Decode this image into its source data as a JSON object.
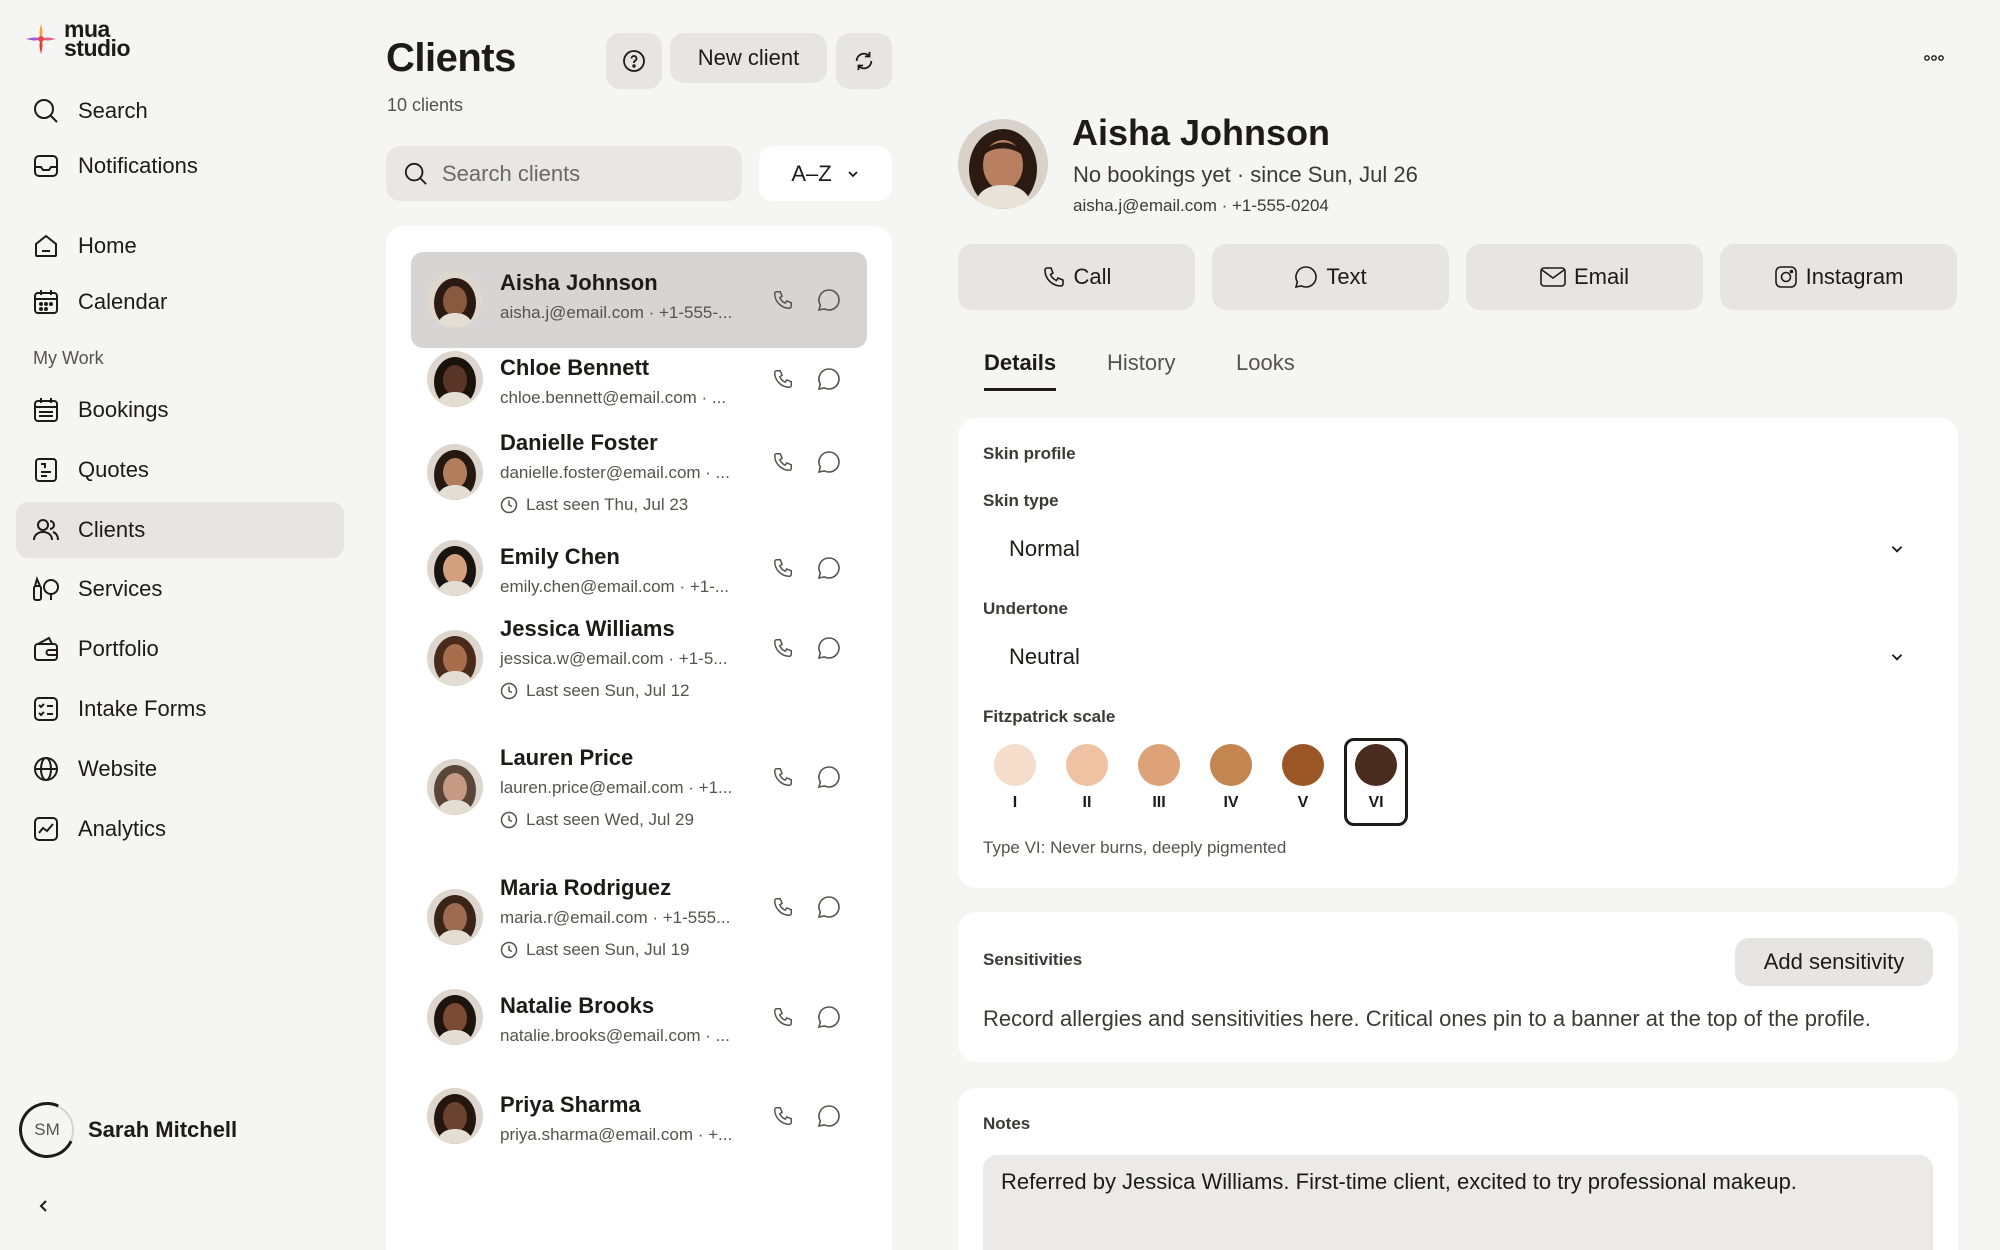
{
  "app": {
    "logo_top": "mua",
    "logo_bottom": "studio"
  },
  "sidebar": {
    "items": [
      {
        "label": "Search",
        "icon": "search-icon"
      },
      {
        "label": "Notifications",
        "icon": "inbox-icon"
      },
      {
        "label": "Home",
        "icon": "home-icon"
      },
      {
        "label": "Calendar",
        "icon": "calendar-icon"
      },
      {
        "label": "Bookings",
        "icon": "calendar-grid-icon"
      },
      {
        "label": "Quotes",
        "icon": "document-icon"
      },
      {
        "label": "Clients",
        "icon": "users-icon"
      },
      {
        "label": "Services",
        "icon": "brush-icon"
      },
      {
        "label": "Portfolio",
        "icon": "wallet-icon"
      },
      {
        "label": "Intake Forms",
        "icon": "checklist-icon"
      },
      {
        "label": "Website",
        "icon": "globe-icon"
      },
      {
        "label": "Analytics",
        "icon": "chart-icon"
      }
    ],
    "section_label": "My Work",
    "user": {
      "initials": "SM",
      "name": "Sarah Mitchell"
    }
  },
  "list": {
    "title": "Clients",
    "count": "10 clients",
    "new_label": "New client",
    "search_placeholder": "Search clients",
    "sort_label": "A–Z",
    "clients": [
      {
        "name": "Aisha Johnson",
        "contact": "aisha.j@email.com · +1-555-...",
        "seen": ""
      },
      {
        "name": "Chloe Bennett",
        "contact": "chloe.bennett@email.com · ...",
        "seen": ""
      },
      {
        "name": "Danielle Foster",
        "contact": "danielle.foster@email.com · ...",
        "seen": "Last seen Thu, Jul 23"
      },
      {
        "name": "Emily Chen",
        "contact": "emily.chen@email.com · +1-...",
        "seen": ""
      },
      {
        "name": "Jessica Williams",
        "contact": "jessica.w@email.com · +1-5...",
        "seen": "Last seen Sun, Jul 12"
      },
      {
        "name": "Lauren Price",
        "contact": "lauren.price@email.com · +1...",
        "seen": "Last seen Wed, Jul 29"
      },
      {
        "name": "Maria Rodriguez",
        "contact": "maria.r@email.com · +1-555...",
        "seen": "Last seen Sun, Jul 19"
      },
      {
        "name": "Natalie Brooks",
        "contact": "natalie.brooks@email.com · ...",
        "seen": ""
      },
      {
        "name": "Priya Sharma",
        "contact": "priya.sharma@email.com · +...",
        "seen": ""
      }
    ]
  },
  "profile": {
    "name": "Aisha Johnson",
    "subtitle": "No bookings yet · since Sun, Jul 26",
    "contact": "aisha.j@email.com · +1-555-0204",
    "actions": {
      "call": "Call",
      "text": "Text",
      "email": "Email",
      "instagram": "Instagram"
    },
    "tabs": [
      "Details",
      "History",
      "Looks"
    ],
    "skin": {
      "section": "Skin profile",
      "skin_type_label": "Skin type",
      "skin_type_value": "Normal",
      "undertone_label": "Undertone",
      "undertone_value": "Neutral",
      "fitz_label": "Fitzpatrick scale",
      "fitz": [
        {
          "label": "I",
          "color": "#f5dccb"
        },
        {
          "label": "II",
          "color": "#eec2a3"
        },
        {
          "label": "III",
          "color": "#dda278"
        },
        {
          "label": "IV",
          "color": "#c48651"
        },
        {
          "label": "V",
          "color": "#9a5725"
        },
        {
          "label": "VI",
          "color": "#4a2d1e"
        }
      ],
      "selected": "VI",
      "fitz_note": "Type VI: Never burns, deeply pigmented"
    },
    "sensitivities": {
      "title": "Sensitivities",
      "add_label": "Add sensitivity",
      "body": "Record allergies and sensitivities here. Critical ones pin to a banner at the top of the profile."
    },
    "notes": {
      "title": "Notes",
      "body": "Referred by Jessica Williams. First-time client, excited to try professional makeup."
    }
  }
}
